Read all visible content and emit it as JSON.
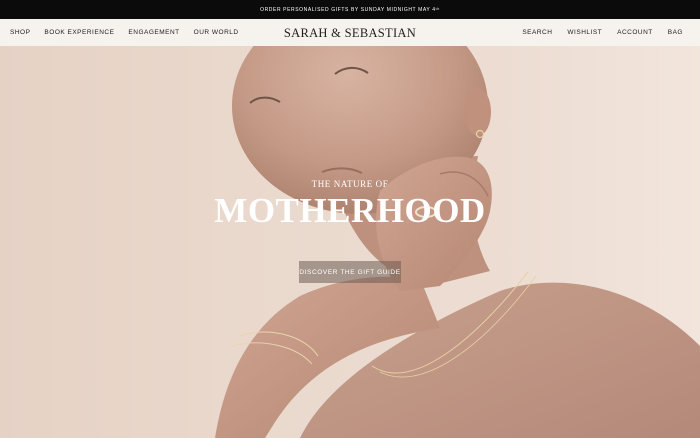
{
  "announcement": {
    "text": "ORDER PERSONALISED GIFTS BY SUNDAY MIDNIGHT MAY 4ᵗʰ"
  },
  "brand": {
    "logo_text": "SARAH & SEBASTIAN"
  },
  "nav_left": [
    {
      "label": "SHOP"
    },
    {
      "label": "BOOK EXPERIENCE"
    },
    {
      "label": "ENGAGEMENT"
    },
    {
      "label": "OUR WORLD"
    }
  ],
  "nav_right": [
    {
      "label": "SEARCH"
    },
    {
      "label": "WISHLIST"
    },
    {
      "label": "ACCOUNT"
    },
    {
      "label": "BAG"
    }
  ],
  "hero": {
    "subtitle": "THE NATURE OF",
    "title": "MOTHERHOOD",
    "cta_label": "DISCOVER THE GIFT GUIDE"
  },
  "colors": {
    "announcement_bg": "#0b0b0b",
    "header_bg": "#f6f3ef",
    "hero_bg": "#ead9cd",
    "cta_bg": "#6e5c54"
  }
}
